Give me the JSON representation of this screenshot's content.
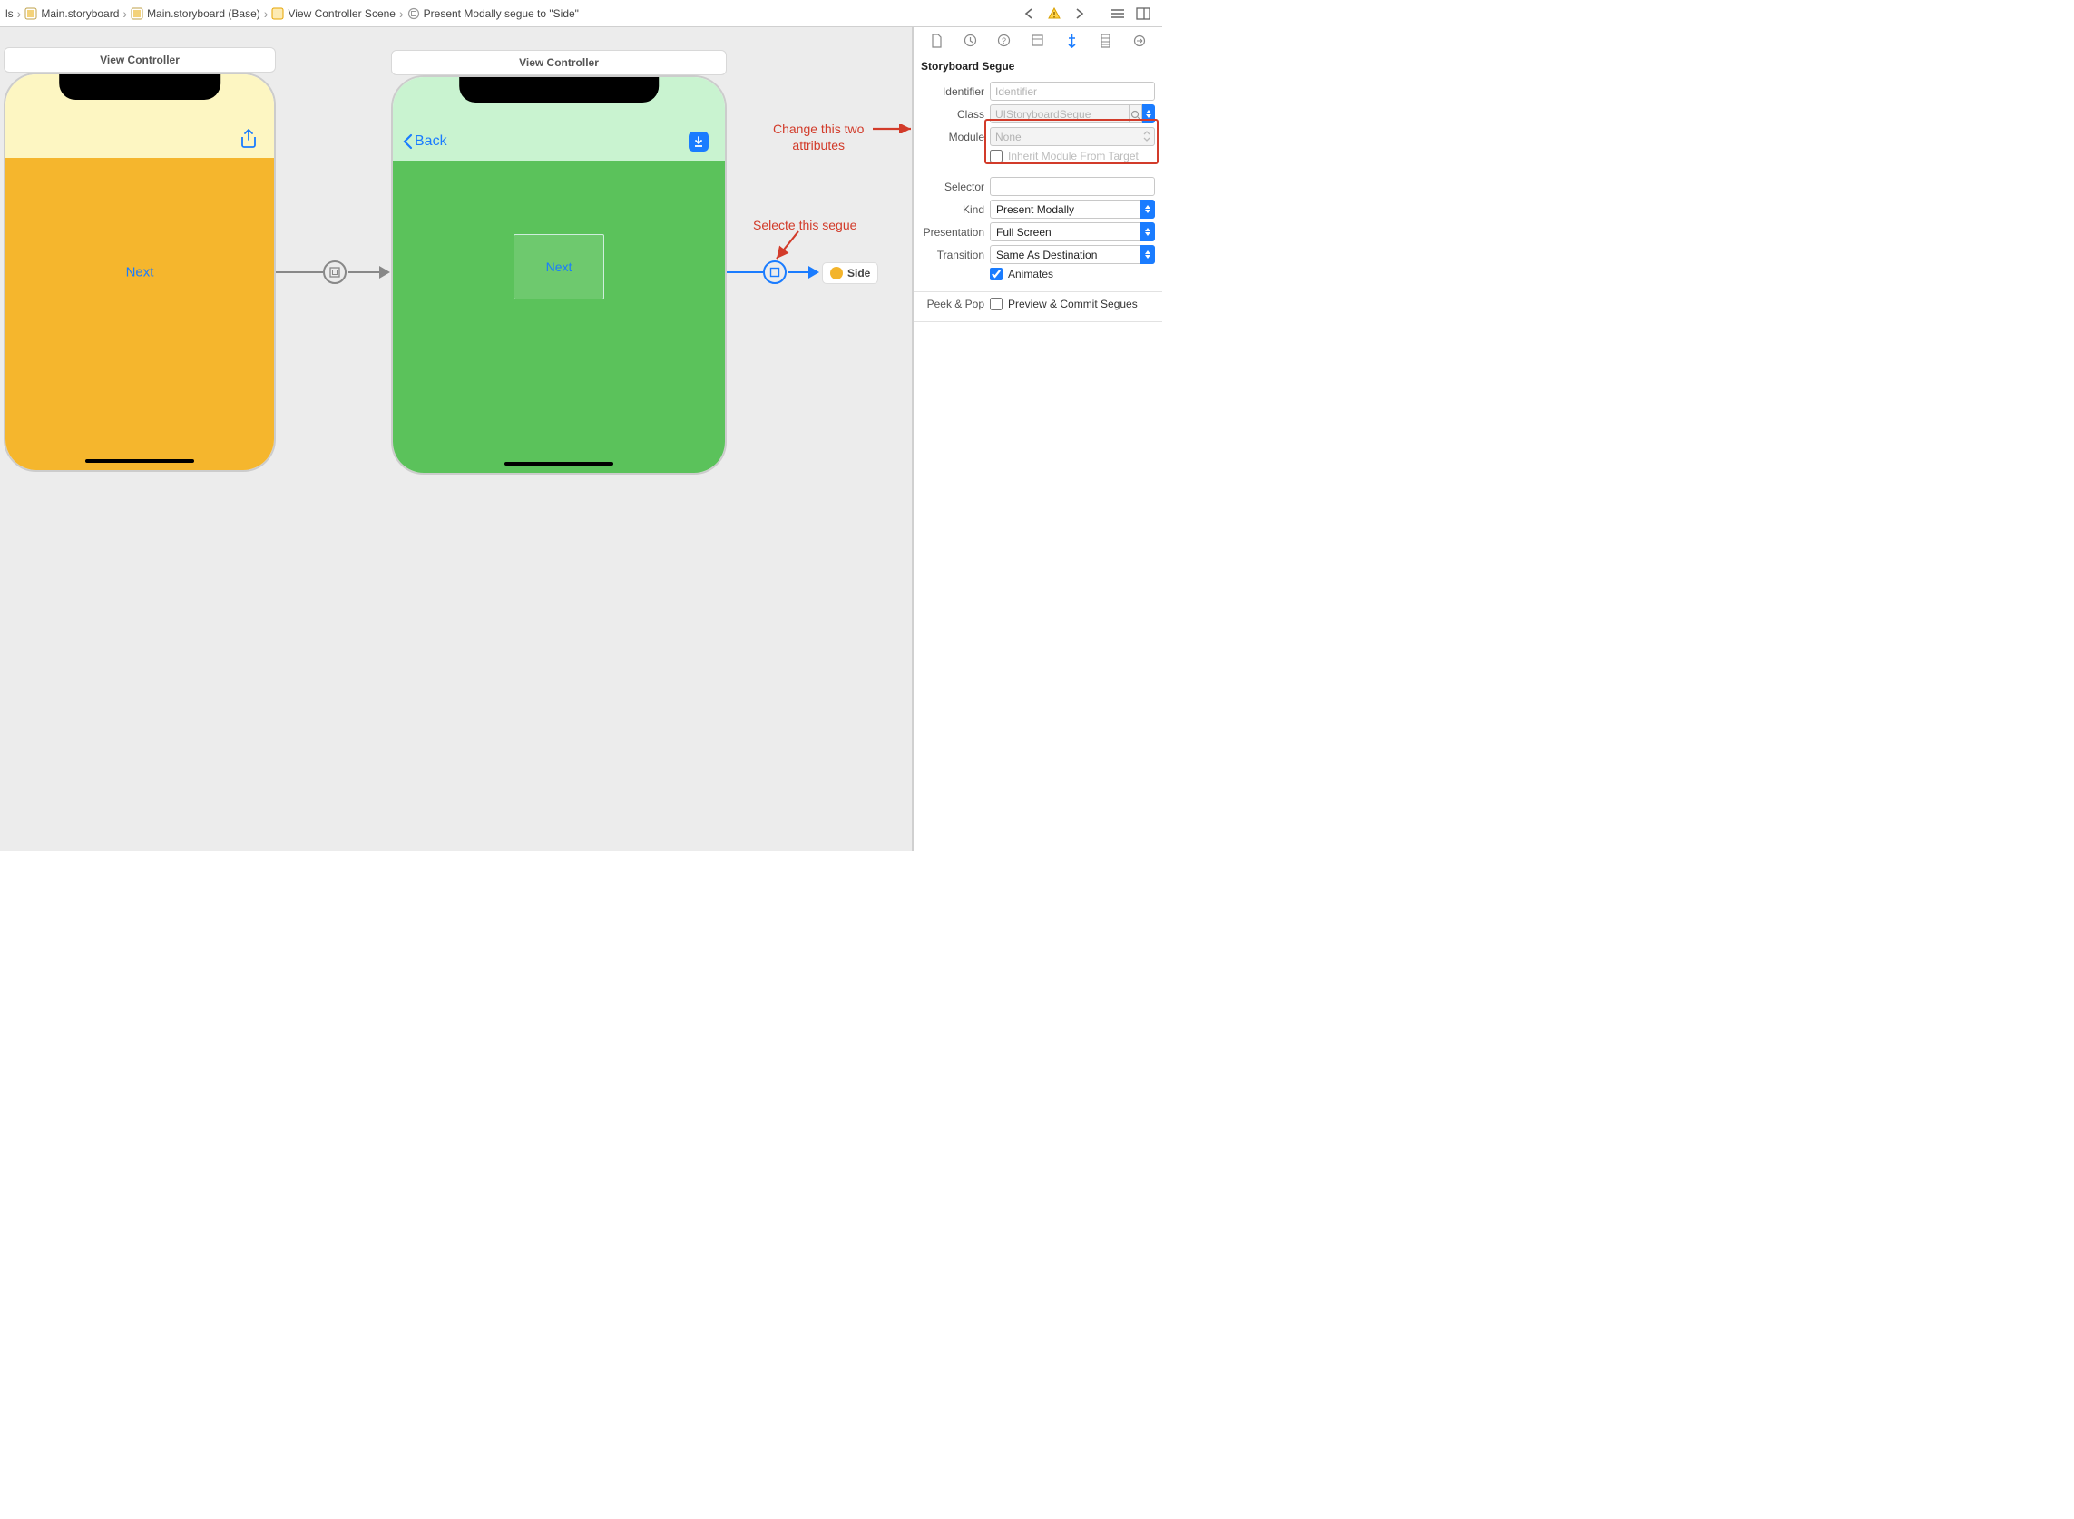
{
  "breadcrumb": {
    "item0": "ls",
    "item1": "Main.storyboard",
    "item2": "Main.storyboard (Base)",
    "item3": "View Controller Scene",
    "item4": "Present Modally segue to \"Side\""
  },
  "scenes": {
    "vc1_title": "View Controller",
    "vc2_title": "View Controller",
    "vc1_next": "Next",
    "vc2_back": "Back",
    "vc2_next": "Next",
    "side_chip": "Side"
  },
  "annotations": {
    "select_segue": "Selecte this segue",
    "change_attrs_l1": "Change this two",
    "change_attrs_l2": "attributes"
  },
  "inspector": {
    "section_title": "Storyboard Segue",
    "labels": {
      "identifier": "Identifier",
      "class": "Class",
      "module": "Module",
      "inherit": "Inherit Module From Target",
      "selector": "Selector",
      "kind": "Kind",
      "presentation": "Presentation",
      "transition": "Transition",
      "animates": "Animates",
      "peekpop": "Peek & Pop",
      "preview_commit": "Preview & Commit Segues"
    },
    "values": {
      "identifier_placeholder": "Identifier",
      "class_placeholder": "UIStoryboardSegue",
      "module_placeholder": "None",
      "kind": "Present Modally",
      "presentation": "Full Screen",
      "transition": "Same As Destination",
      "animates_checked": true,
      "inherit_checked": false,
      "preview_commit_checked": false
    }
  }
}
